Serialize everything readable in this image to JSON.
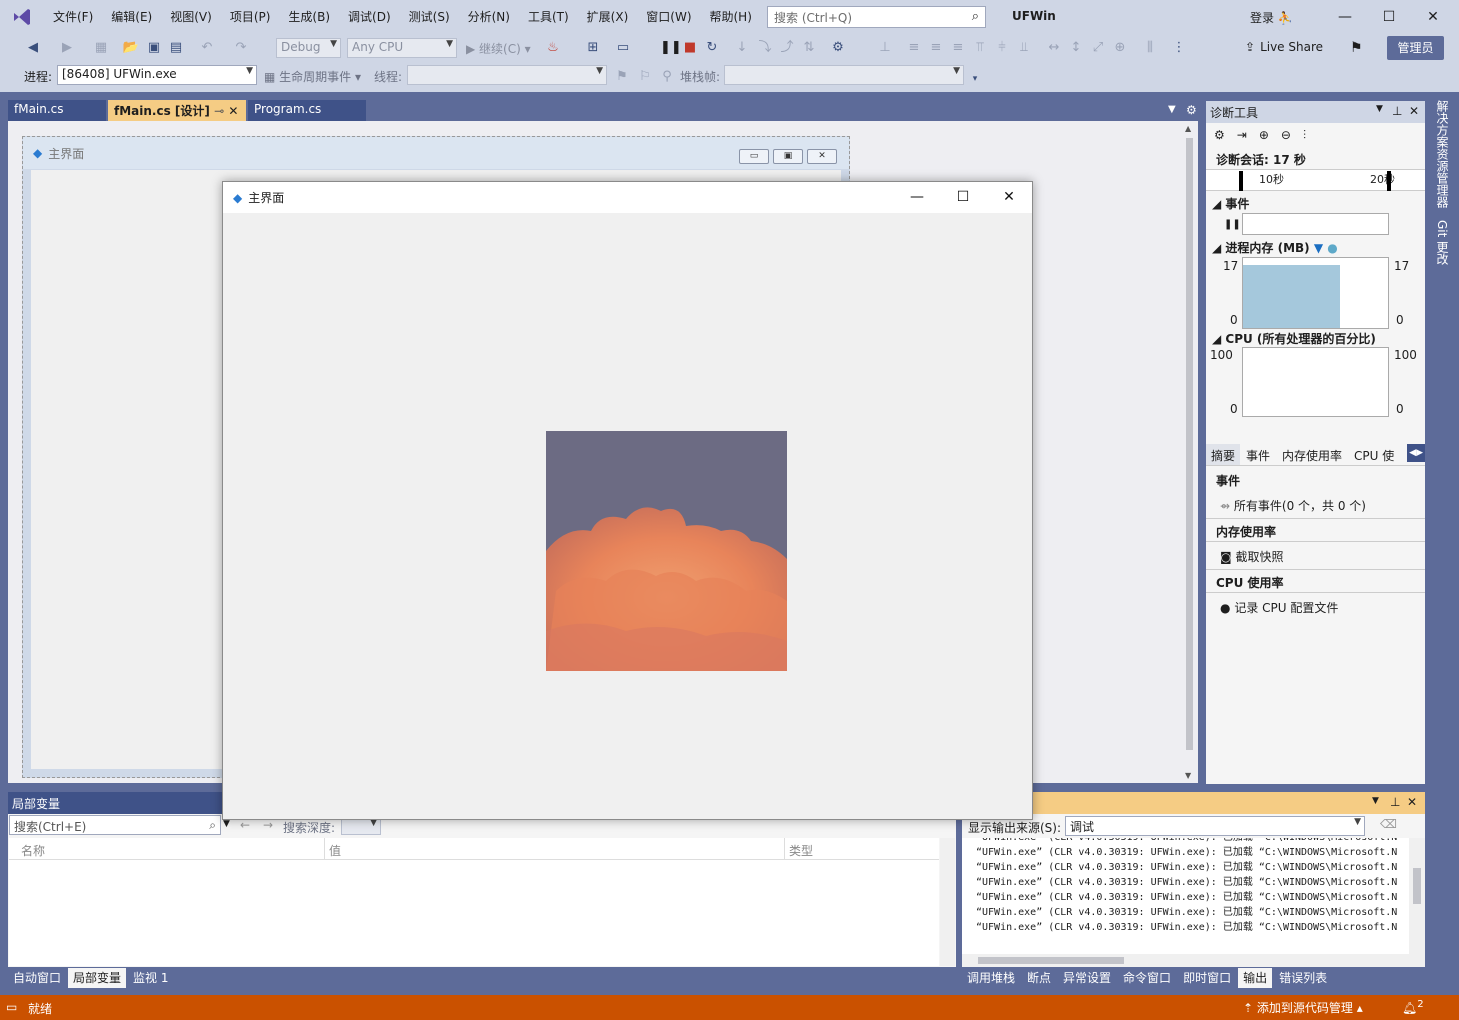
{
  "menu": [
    "文件(F)",
    "编辑(E)",
    "视图(V)",
    "项目(P)",
    "生成(B)",
    "调试(D)",
    "测试(S)",
    "分析(N)",
    "工具(T)",
    "扩展(X)",
    "窗口(W)",
    "帮助(H)"
  ],
  "search": {
    "placeholder": "搜索 (Ctrl+Q)"
  },
  "app_title": "UFWin",
  "login": "登录",
  "window_buttons": {
    "minimize": "—",
    "maximize": "☐",
    "close": "✕"
  },
  "toolbar": {
    "config": "Debug",
    "platform": "Any CPU",
    "continue": "继续(C)",
    "liveshare": "Live Share",
    "admin": "管理员"
  },
  "toolbar2": {
    "process_label": "进程:",
    "process_value": "[86408] UFWin.exe",
    "lifecycle": "生命周期事件",
    "thread_label": "线程:",
    "stack_label": "堆栈帧:"
  },
  "tabs": [
    {
      "label": "fMain.cs"
    },
    {
      "label": "fMain.cs [设计]",
      "active": true
    },
    {
      "label": "Program.cs"
    }
  ],
  "designer_form_title": "主界面",
  "running_window": {
    "title": "主界面"
  },
  "diag": {
    "title": "诊断工具",
    "session": "诊断会话: 17 秒",
    "tick1": "10秒",
    "tick2": "20秒",
    "events": "事件",
    "memory": "进程内存 (MB)",
    "mem_max": "17",
    "mem_min": "0",
    "cpu": "CPU (所有处理器的百分比)",
    "cpu_max": "100",
    "cpu_min": "0",
    "subtabs": [
      "摘要",
      "事件",
      "内存使用率",
      "CPU 使"
    ],
    "sec_events": "事件",
    "all_events": "所有事件(0 个，共 0 个)",
    "sec_memory": "内存使用率",
    "snapshot": "截取快照",
    "sec_cpu": "CPU 使用率",
    "record_cpu": "记录 CPU 配置文件"
  },
  "side_tabs": [
    "解决方案资源管理器",
    "Git 更改"
  ],
  "locals": {
    "title": "局部变量",
    "search_placeholder": "搜索(Ctrl+E)",
    "depth_label": "搜索深度:",
    "col_name": "名称",
    "col_value": "值",
    "col_type": "类型"
  },
  "output": {
    "source_label": "显示输出来源(S):",
    "source_value": "调试",
    "lines": [
      "“UFWin.exe” (CLR v4.0.30319: UFWin.exe): 已加载 “C:\\WINDOWS\\Microsoft.N",
      "“UFWin.exe” (CLR v4.0.30319: UFWin.exe): 已加载 “C:\\WINDOWS\\Microsoft.N",
      "“UFWin.exe” (CLR v4.0.30319: UFWin.exe): 已加载 “C:\\WINDOWS\\Microsoft.N",
      "“UFWin.exe” (CLR v4.0.30319: UFWin.exe): 已加载 “C:\\WINDOWS\\Microsoft.N",
      "“UFWin.exe” (CLR v4.0.30319: UFWin.exe): 已加载 “C:\\WINDOWS\\Microsoft.N",
      "“UFWin.exe” (CLR v4.0.30319: UFWin.exe): 已加载 “C:\\WINDOWS\\Microsoft.N",
      "“UFWin.exe” (CLR v4.0.30319: UFWin.exe): 已加载 “C:\\WINDOWS\\Microsoft.N"
    ]
  },
  "bottom_tabs_left": [
    "自动窗口",
    "局部变量",
    "监视 1"
  ],
  "bottom_tabs_right": [
    "调用堆栈",
    "断点",
    "异常设置",
    "命令窗口",
    "即时窗口",
    "输出",
    "错误列表"
  ],
  "status": {
    "ready": "就绪",
    "source_control": "添加到源代码管理",
    "notifications": "2"
  },
  "colors": {
    "accent": "#5d6b99",
    "status": "#ca5100",
    "tab_active": "#f5cc84"
  }
}
